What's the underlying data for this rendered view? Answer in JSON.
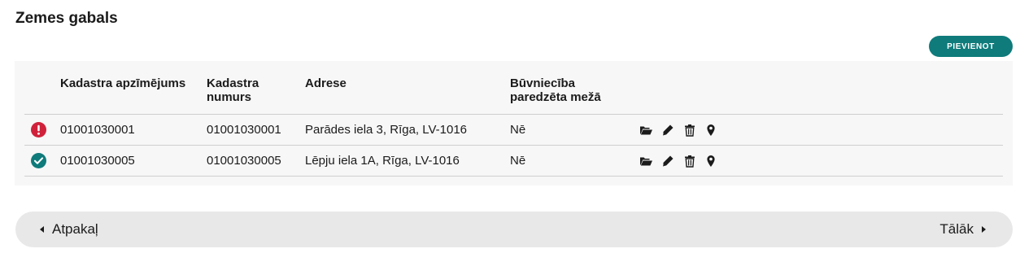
{
  "page": {
    "title": "Zemes gabals"
  },
  "toolbar": {
    "add_label": "PIEVIENOT"
  },
  "table": {
    "headers": {
      "cadastral_designation": "Kadastra apzīmējums",
      "cadastral_number_line1": "Kadastra",
      "cadastral_number_line2": "numurs",
      "address": "Adrese",
      "forest_line1": "Būvniecība",
      "forest_line2": "paredzēta mežā"
    },
    "rows": [
      {
        "status": "error",
        "status_icon": "exclamation-circle-icon",
        "status_color": "#d0213a",
        "cadastral_designation": "01001030001",
        "cadastral_number": "01001030001",
        "address": "Parādes iela 3, Rīga, LV-1016",
        "forest": "Nē"
      },
      {
        "status": "ok",
        "status_icon": "check-circle-icon",
        "status_color": "#0f7b7b",
        "cadastral_designation": "01001030005",
        "cadastral_number": "01001030005",
        "address": "Lēpju iela 1A, Rīga, LV-1016",
        "forest": "Nē"
      }
    ],
    "row_actions": [
      "folder-open-icon",
      "pencil-icon",
      "trash-icon",
      "map-marker-icon"
    ]
  },
  "navigation": {
    "back_label": "Atpakaļ",
    "next_label": "Tālāk"
  },
  "colors": {
    "accent": "#0f7b7b",
    "error": "#d0213a",
    "panel": "#f7f7f7",
    "nav_bar": "#e8e8e8"
  }
}
